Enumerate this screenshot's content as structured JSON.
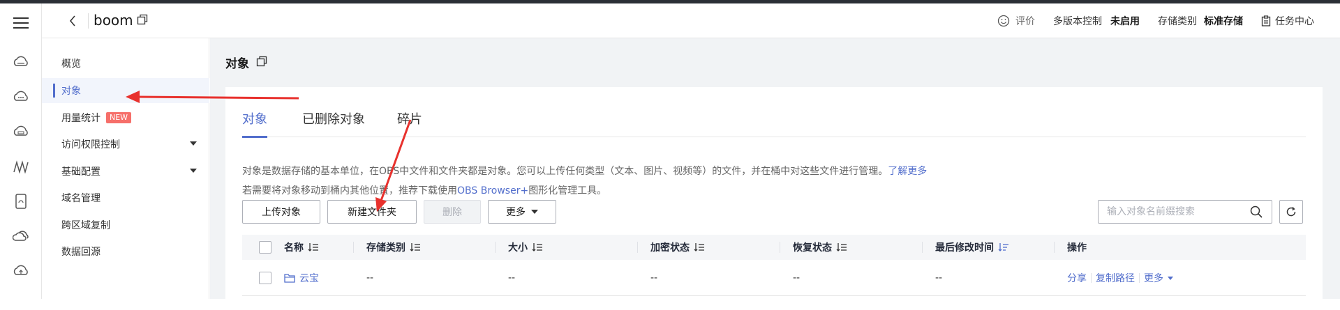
{
  "header": {
    "bucket_name": "boom",
    "feedback_label": "评价",
    "versioning_label": "多版本控制",
    "versioning_value": "未启用",
    "storage_class_label": "存储类别",
    "storage_class_value": "标准存储",
    "task_center_label": "任务中心"
  },
  "rail": {
    "icons": [
      "cloud-storage-icon",
      "cloud-dots-icon",
      "cloud-drive-icon",
      "signal-icon",
      "disk-icon",
      "stacked-clouds-icon",
      "cloud-upload-icon"
    ]
  },
  "sidebar": {
    "items": [
      {
        "label": "概览"
      },
      {
        "label": "对象"
      },
      {
        "label": "用量统计",
        "badge": "NEW"
      },
      {
        "label": "访问权限控制"
      },
      {
        "label": "基础配置"
      },
      {
        "label": "域名管理"
      },
      {
        "label": "跨区域复制"
      },
      {
        "label": "数据回源"
      }
    ]
  },
  "main": {
    "page_title": "对象",
    "tabs": [
      "对象",
      "已删除对象",
      "碎片"
    ],
    "desc_line1": "对象是数据存储的基本单位，在OBS中文件和文件夹都是对象。您可以上传任何类型（文本、图片、视频等）的文件，并在桶中对这些文件进行管理。",
    "desc_line1_link": "了解更多",
    "desc_line2_pre": "若需要将对象移动到桶内其他位置，推荐下载使用",
    "desc_line2_link": "OBS Browser+",
    "desc_line2_post": "图形化管理工具。",
    "toolbar": {
      "upload": "上传对象",
      "new_folder": "新建文件夹",
      "delete": "删除",
      "more": "更多"
    },
    "search_placeholder": "输入对象名前缀搜索",
    "columns": [
      "名称",
      "存储类别",
      "大小",
      "加密状态",
      "恢复状态",
      "最后修改时间",
      "操作"
    ],
    "rows": [
      {
        "name": "云宝",
        "storage_class": "--",
        "size": "--",
        "encryption": "--",
        "restore": "--",
        "modified": "--",
        "ops": [
          "分享",
          "复制路径",
          "更多"
        ]
      }
    ]
  },
  "colors": {
    "accent": "#526ecc",
    "annotation_red": "#e8312d",
    "badge_red": "#f66f6a"
  }
}
